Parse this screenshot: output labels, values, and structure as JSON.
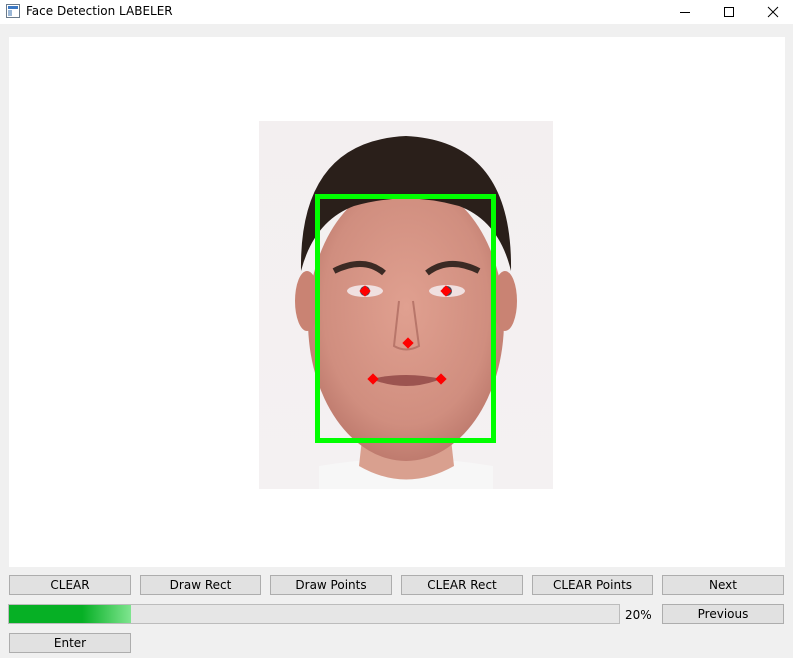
{
  "window": {
    "title": "Face Detection LABELER",
    "icon": "window-app-icon",
    "controls": [
      "minimize-icon",
      "maximize-icon",
      "close-icon"
    ]
  },
  "canvas": {
    "image_subject": "frontal face photo",
    "face_rect_color": "#00ff00",
    "landmark_color": "#ff0000",
    "landmark_count": 5
  },
  "toolbar": {
    "clear_label": "CLEAR",
    "draw_rect_label": "Draw Rect",
    "draw_points_label": "Draw Points",
    "clear_rect_label": "CLEAR Rect",
    "clear_points_label": "CLEAR Points",
    "next_label": "Next",
    "previous_label": "Previous",
    "enter_label": "Enter"
  },
  "progress": {
    "value": 0.2,
    "label": "20%",
    "fill_color": "#06b025"
  }
}
